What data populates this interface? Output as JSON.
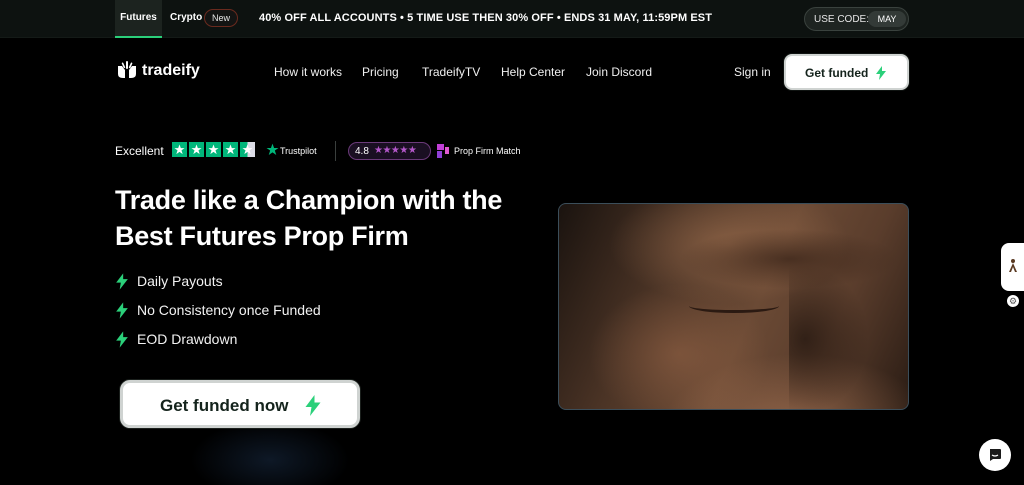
{
  "promo_bar": {
    "tabs": [
      {
        "label": "Futures",
        "active": true
      },
      {
        "label": "Crypto",
        "active": false
      }
    ],
    "new_badge": "New",
    "message": "40% OFF ALL ACCOUNTS  •  5 TIME USE THEN 30% OFF  •  ENDS 31 MAY, 11:59PM EST",
    "code_label": "USE CODE:",
    "code_value": "MAY"
  },
  "nav": {
    "logo_text": "tradeify",
    "links": [
      "How it works",
      "Pricing",
      "TradeifyTV",
      "Help Center",
      "Join Discord"
    ],
    "sign_in": "Sign in",
    "cta": "Get funded"
  },
  "ratings": {
    "trustpilot_label": "Excellent",
    "trustpilot_stars": 4.5,
    "trustpilot_brand": "Trustpilot",
    "pfm_score": "4.8",
    "pfm_stars": "★★★★★",
    "pfm_brand": "Prop Firm Match"
  },
  "hero": {
    "title": "Trade like a Champion with the Best Futures Prop Firm",
    "features": [
      "Daily Payouts",
      "No Consistency once Funded",
      "EOD Drawdown"
    ],
    "cta": "Get funded now"
  },
  "colors": {
    "accent_green": "#2bd07a",
    "trustpilot_green": "#00b67a",
    "pfm_purple": "#b357c9",
    "background": "#000000"
  },
  "icons": {
    "bolt": "lightning-bolt-icon",
    "logo": "raised-hands-icon",
    "side_tab": "figure-icon",
    "chat": "chat-icon"
  }
}
